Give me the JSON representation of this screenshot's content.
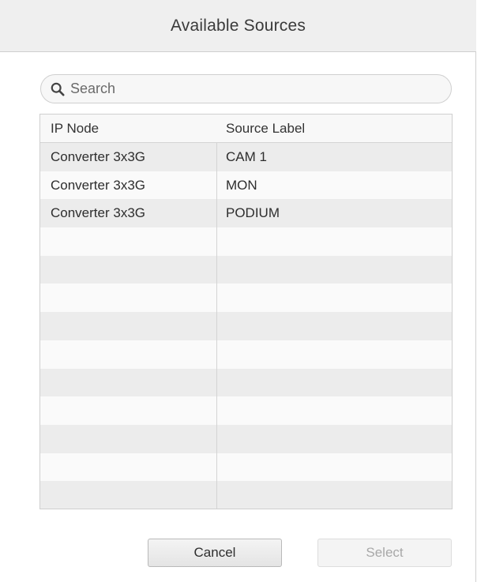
{
  "dialog": {
    "title": "Available Sources"
  },
  "search": {
    "placeholder": "Search",
    "value": ""
  },
  "table": {
    "columns": [
      "IP Node",
      "Source Label"
    ],
    "rows": [
      {
        "ip_node": "Converter 3x3G",
        "source_label": "CAM 1"
      },
      {
        "ip_node": "Converter 3x3G",
        "source_label": "MON"
      },
      {
        "ip_node": "Converter 3x3G",
        "source_label": "PODIUM"
      },
      {
        "ip_node": "",
        "source_label": ""
      },
      {
        "ip_node": "",
        "source_label": ""
      },
      {
        "ip_node": "",
        "source_label": ""
      },
      {
        "ip_node": "",
        "source_label": ""
      },
      {
        "ip_node": "",
        "source_label": ""
      },
      {
        "ip_node": "",
        "source_label": ""
      },
      {
        "ip_node": "",
        "source_label": ""
      },
      {
        "ip_node": "",
        "source_label": ""
      },
      {
        "ip_node": "",
        "source_label": ""
      },
      {
        "ip_node": "",
        "source_label": ""
      }
    ]
  },
  "buttons": {
    "cancel_label": "Cancel",
    "select_label": "Select",
    "select_enabled": false
  },
  "icons": {
    "search": "search-icon"
  },
  "colors": {
    "titlebar_bg": "#efefef",
    "row_odd": "#ececec",
    "row_even": "#fafafa",
    "disabled_text": "#a8a8a8"
  }
}
